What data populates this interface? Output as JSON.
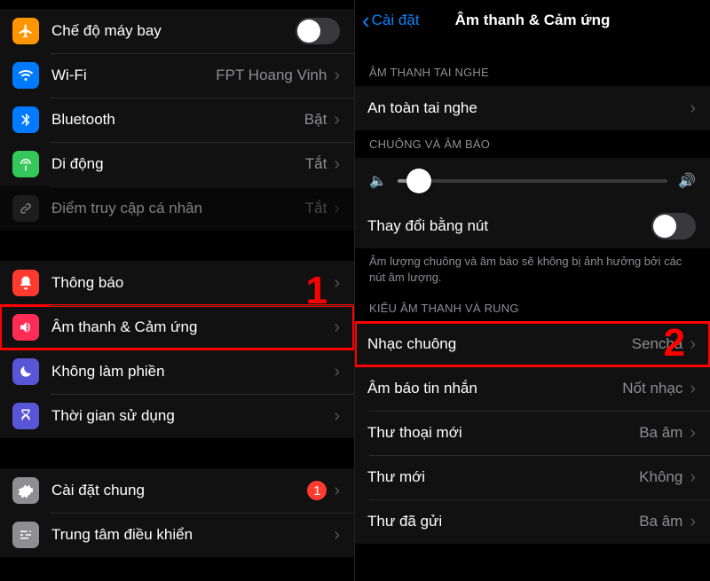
{
  "annotations": {
    "step1": "1",
    "step2": "2"
  },
  "left": {
    "groups": [
      {
        "rows": [
          {
            "icon": "airplane",
            "icon_cls": "c-orange",
            "label": "Chế độ máy bay",
            "kind": "toggle",
            "on": false
          },
          {
            "icon": "wifi",
            "icon_cls": "c-blue",
            "label": "Wi-Fi",
            "value": "FPT Hoang Vinh",
            "kind": "link"
          },
          {
            "icon": "bluetooth",
            "icon_cls": "c-blue",
            "label": "Bluetooth",
            "value": "Bật",
            "kind": "link"
          },
          {
            "icon": "antenna",
            "icon_cls": "c-green",
            "label": "Di động",
            "value": "Tắt",
            "kind": "link"
          },
          {
            "icon": "link",
            "icon_cls": "c-gray",
            "label": "Điểm truy cập cá nhân",
            "value": "Tắt",
            "kind": "link",
            "dim": true
          }
        ]
      },
      {
        "rows": [
          {
            "icon": "bell",
            "icon_cls": "c-red",
            "label": "Thông báo",
            "kind": "link"
          },
          {
            "icon": "speaker",
            "icon_cls": "c-pink",
            "label": "Âm thanh & Cảm ứng",
            "kind": "link",
            "highlight": true
          },
          {
            "icon": "moon",
            "icon_cls": "c-purple",
            "label": "Không làm phiền",
            "kind": "link"
          },
          {
            "icon": "hourglass",
            "icon_cls": "c-purple",
            "label": "Thời gian sử dụng",
            "kind": "link"
          }
        ]
      },
      {
        "rows": [
          {
            "icon": "gear",
            "icon_cls": "c-settings",
            "label": "Cài đặt chung",
            "badge": "1",
            "kind": "link"
          },
          {
            "icon": "sliders",
            "icon_cls": "c-settings",
            "label": "Trung tâm điều khiển",
            "kind": "link"
          }
        ]
      }
    ]
  },
  "right": {
    "back": "Cài đặt",
    "title": "Âm thanh & Cảm ứng",
    "sections": [
      {
        "header": "ÂM THANH TAI NGHE",
        "rows": [
          {
            "label": "An toàn tai nghe",
            "kind": "link"
          }
        ]
      },
      {
        "header": "CHUÔNG VÀ ÂM BÁO",
        "slider": {
          "position_pct": 8
        },
        "rows": [
          {
            "label": "Thay đổi bằng nút",
            "kind": "toggle",
            "on": false
          }
        ],
        "footer": "Âm lượng chuông và âm báo sẽ không bị ảnh hưởng bởi các nút âm lượng."
      },
      {
        "header": "KIỂU ÂM THANH VÀ RUNG",
        "rows": [
          {
            "label": "Nhạc chuông",
            "value": "Sencha",
            "kind": "link",
            "highlight": true
          },
          {
            "label": "Âm báo tin nhắn",
            "value": "Nốt nhạc",
            "kind": "link"
          },
          {
            "label": "Thư thoại mới",
            "value": "Ba âm",
            "kind": "link"
          },
          {
            "label": "Thư mới",
            "value": "Không",
            "kind": "link"
          },
          {
            "label": "Thư đã gửi",
            "value": "Ba âm",
            "kind": "link"
          }
        ]
      }
    ]
  }
}
